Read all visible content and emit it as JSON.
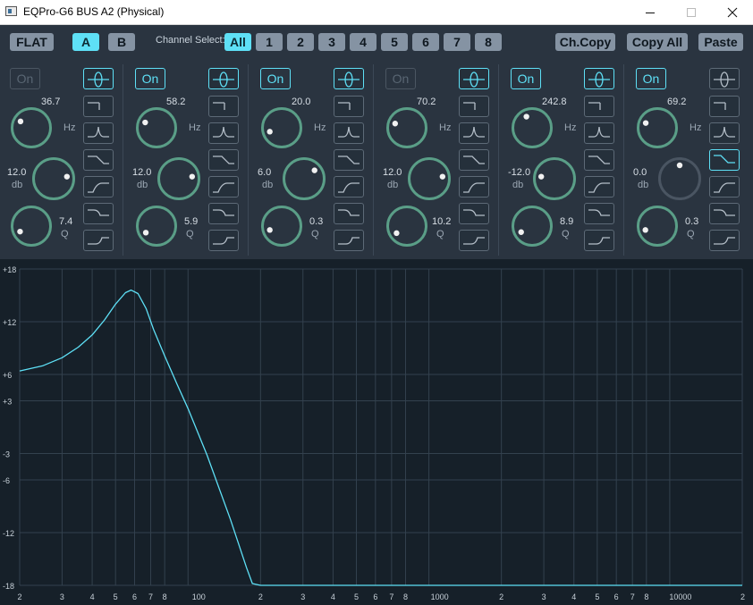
{
  "window": {
    "title": "EQPro-G6 BUS A2 (Physical)"
  },
  "toolbar": {
    "flat_label": "FLAT",
    "preset_a_label": "A",
    "preset_b_label": "B",
    "channel_select_label": "Channel Select:",
    "channel_all_label": "All",
    "channels": [
      "1",
      "2",
      "3",
      "4",
      "5",
      "6",
      "7",
      "8"
    ],
    "ch_copy_label": "Ch.Copy",
    "copy_all_label": "Copy All",
    "paste_label": "Paste"
  },
  "units": {
    "hz": "Hz",
    "db": "db",
    "q": "Q"
  },
  "bands": [
    {
      "on_label": "On",
      "enabled": false,
      "freq": "36.7",
      "gain": "12.0",
      "q": "7.4",
      "type": "peak",
      "freq_pos": 0.28,
      "gain_pos": 0.8,
      "q_pos": 0.07,
      "gain_active": true
    },
    {
      "on_label": "On",
      "enabled": true,
      "freq": "58.2",
      "gain": "12.0",
      "q": "5.9",
      "type": "peak",
      "freq_pos": 0.26,
      "gain_pos": 0.8,
      "q_pos": 0.05,
      "gain_active": true
    },
    {
      "on_label": "On",
      "enabled": true,
      "freq": "20.0",
      "gain": "6.0",
      "q": "0.3",
      "type": "peak",
      "freq_pos": 0.1,
      "gain_pos": 0.69,
      "q_pos": 0.1,
      "gain_active": true
    },
    {
      "on_label": "On",
      "enabled": false,
      "freq": "70.2",
      "gain": "12.0",
      "q": "10.2",
      "type": "peak",
      "freq_pos": 0.24,
      "gain_pos": 0.8,
      "q_pos": 0.04,
      "gain_active": true
    },
    {
      "on_label": "On",
      "enabled": true,
      "freq": "242.8",
      "gain": "-12.0",
      "q": "8.9",
      "type": "peak",
      "freq_pos": 0.4,
      "gain_pos": 0.2,
      "q_pos": 0.06,
      "gain_active": true
    },
    {
      "on_label": "On",
      "enabled": true,
      "freq": "69.2",
      "gain": "0.0",
      "q": "0.3",
      "type": "high-shelf",
      "freq_pos": 0.25,
      "gain_pos": 0.5,
      "q_pos": 0.1,
      "gain_active": false
    }
  ],
  "filter_types": [
    "peak",
    "low-cut",
    "bandpass",
    "high-shelf-cut",
    "high-pass",
    "low-shelf",
    "low-shelf-cut"
  ],
  "colors": {
    "accent": "#5ee0f6",
    "knob_ring": "#5a9e87",
    "curve": "#5ee0f6",
    "grid": "#2f3d4a"
  },
  "chart_data": {
    "type": "line",
    "x_scale": "log",
    "xlim": [
      20,
      20000
    ],
    "ylim": [
      -18,
      18
    ],
    "y_ticks": [
      "+18",
      "+12",
      "+6",
      "+3",
      "-3",
      "-6",
      "-12",
      "-18"
    ],
    "y_tick_values": [
      18,
      12,
      6,
      3,
      -3,
      -6,
      -12,
      -18
    ],
    "x_tick_labels": [
      "2",
      "3",
      "4",
      "5",
      "6",
      "7",
      "8",
      "100",
      "2",
      "3",
      "4",
      "5",
      "6",
      "7",
      "8",
      "1000",
      "2",
      "3",
      "4",
      "5",
      "6",
      "7",
      "8",
      "10000",
      "2"
    ],
    "x_tick_values": [
      20,
      30,
      40,
      50,
      60,
      70,
      80,
      100,
      200,
      300,
      400,
      500,
      600,
      700,
      800,
      1000,
      2000,
      3000,
      4000,
      5000,
      6000,
      7000,
      8000,
      10000,
      20000
    ],
    "series": [
      {
        "x": [
          20,
          25,
          30,
          35,
          40,
          45,
          50,
          55,
          58,
          62,
          67,
          72,
          80,
          90,
          100,
          120,
          150,
          175,
          185,
          200,
          300,
          1000,
          20000
        ],
        "y": [
          6.4,
          7.0,
          7.9,
          9.1,
          10.5,
          12.2,
          14.0,
          15.3,
          15.6,
          15.2,
          13.5,
          11.1,
          8.1,
          4.9,
          2.1,
          -3.2,
          -10.5,
          -16.0,
          -17.8,
          -18,
          -18,
          -18,
          -18
        ]
      }
    ]
  }
}
